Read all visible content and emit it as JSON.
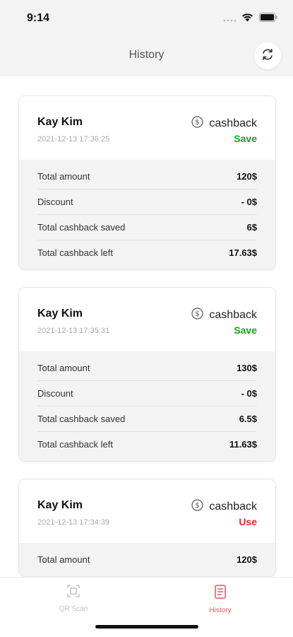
{
  "status_bar": {
    "time": "9:14"
  },
  "header": {
    "title": "History"
  },
  "cards": [
    {
      "name": "Kay Kim",
      "date": "2021-12-13 17:36:25",
      "type": "cashback",
      "status": "Save",
      "status_color": "#1aa31a",
      "rows": [
        {
          "label": "Total amount",
          "value": "120$"
        },
        {
          "label": "Discount",
          "value": "- 0$"
        },
        {
          "label": "Total cashback saved",
          "value": "6$"
        },
        {
          "label": "Total cashback left",
          "value": "17.63$"
        }
      ]
    },
    {
      "name": "Kay Kim",
      "date": "2021-12-13 17:35:31",
      "type": "cashback",
      "status": "Save",
      "status_color": "#1aa31a",
      "rows": [
        {
          "label": "Total amount",
          "value": "130$"
        },
        {
          "label": "Discount",
          "value": "- 0$"
        },
        {
          "label": "Total cashback saved",
          "value": "6.5$"
        },
        {
          "label": "Total cashback left",
          "value": "11.63$"
        }
      ]
    },
    {
      "name": "Kay Kim",
      "date": "2021-12-13 17:34:39",
      "type": "cashback",
      "status": "Use",
      "status_color": "#e0262b",
      "rows": [
        {
          "label": "Total amount",
          "value": "120$"
        }
      ]
    }
  ],
  "tabs": [
    {
      "label": "QR Scan",
      "icon": "qr-scan-icon",
      "active": false
    },
    {
      "label": "History",
      "icon": "history-icon",
      "active": true
    }
  ],
  "colors": {
    "active_tab": "#e0565b",
    "inactive_tab": "#c2c2c2"
  }
}
